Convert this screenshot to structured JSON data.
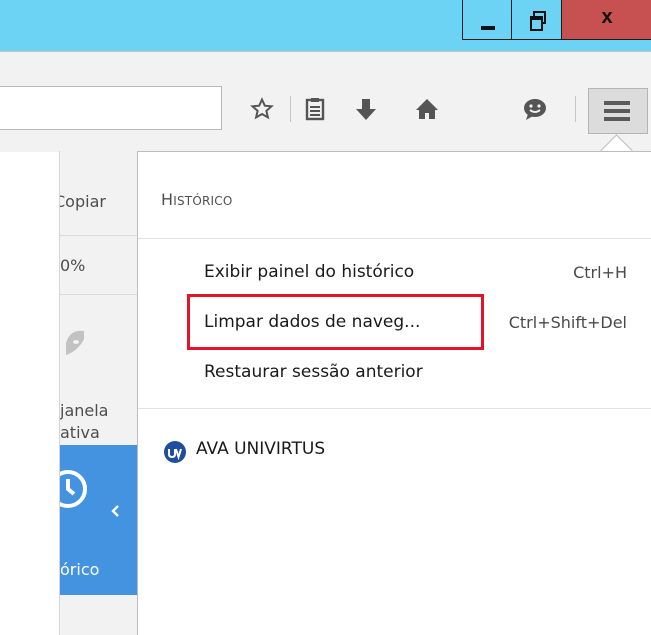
{
  "window": {
    "minimize_label": "minimize",
    "maximize_label": "restore",
    "close_label": "x"
  },
  "toolbar": {
    "url_value": "",
    "icons": [
      "star-bookmark-icon",
      "reading-list-icon",
      "download-arrow-icon",
      "home-icon",
      "chat-smiley-icon",
      "hamburger-menu-icon"
    ]
  },
  "side_panel": {
    "copy_label": "Copiar",
    "zoom_label": "0%",
    "private_line1": "janela",
    "private_line2": "ativa",
    "history_label": "órico"
  },
  "history_menu": {
    "header_first": "H",
    "header_rest": "ISTÓRICO",
    "items": [
      {
        "label": "Exibir painel do histórico",
        "shortcut": "Ctrl+H"
      },
      {
        "label": "Limpar dados de naveg...",
        "shortcut": "Ctrl+Shift+Del"
      },
      {
        "label": "Restaurar sessão anterior",
        "shortcut": ""
      }
    ],
    "bookmarks": [
      {
        "label": "AVA UNIVIRTUS"
      }
    ]
  },
  "colors": {
    "titlebar": "#6dd3f5",
    "close": "#c75050",
    "highlight": "#e2142a",
    "panel_blue": "#4493e0"
  }
}
